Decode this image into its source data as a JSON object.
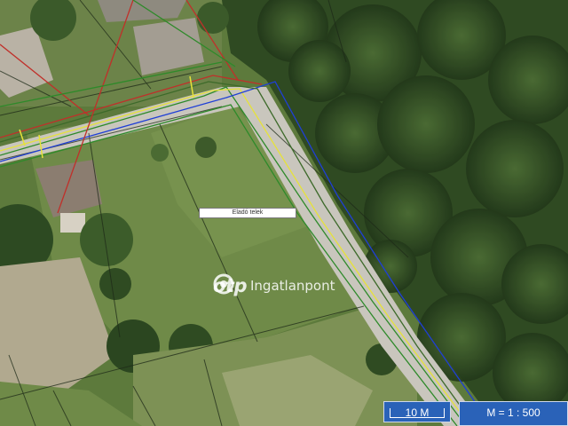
{
  "map": {
    "plot_label": "Eladó telek",
    "watermark": {
      "brand": "otp",
      "subtitle": "Ingatlanpont"
    },
    "scale_bar": {
      "label": "10 M"
    },
    "ratio": {
      "label": "M = 1 : 500"
    }
  },
  "colors": {
    "forest": "#2f4a22",
    "grass": "#6f8a48",
    "road": "#c9c6bd",
    "line_blue": "#1f3fd6",
    "line_yellow": "#e6e23a",
    "line_green": "#2e8a2a",
    "line_red": "#c0302a",
    "overlay_brand": "#2a62b8"
  }
}
